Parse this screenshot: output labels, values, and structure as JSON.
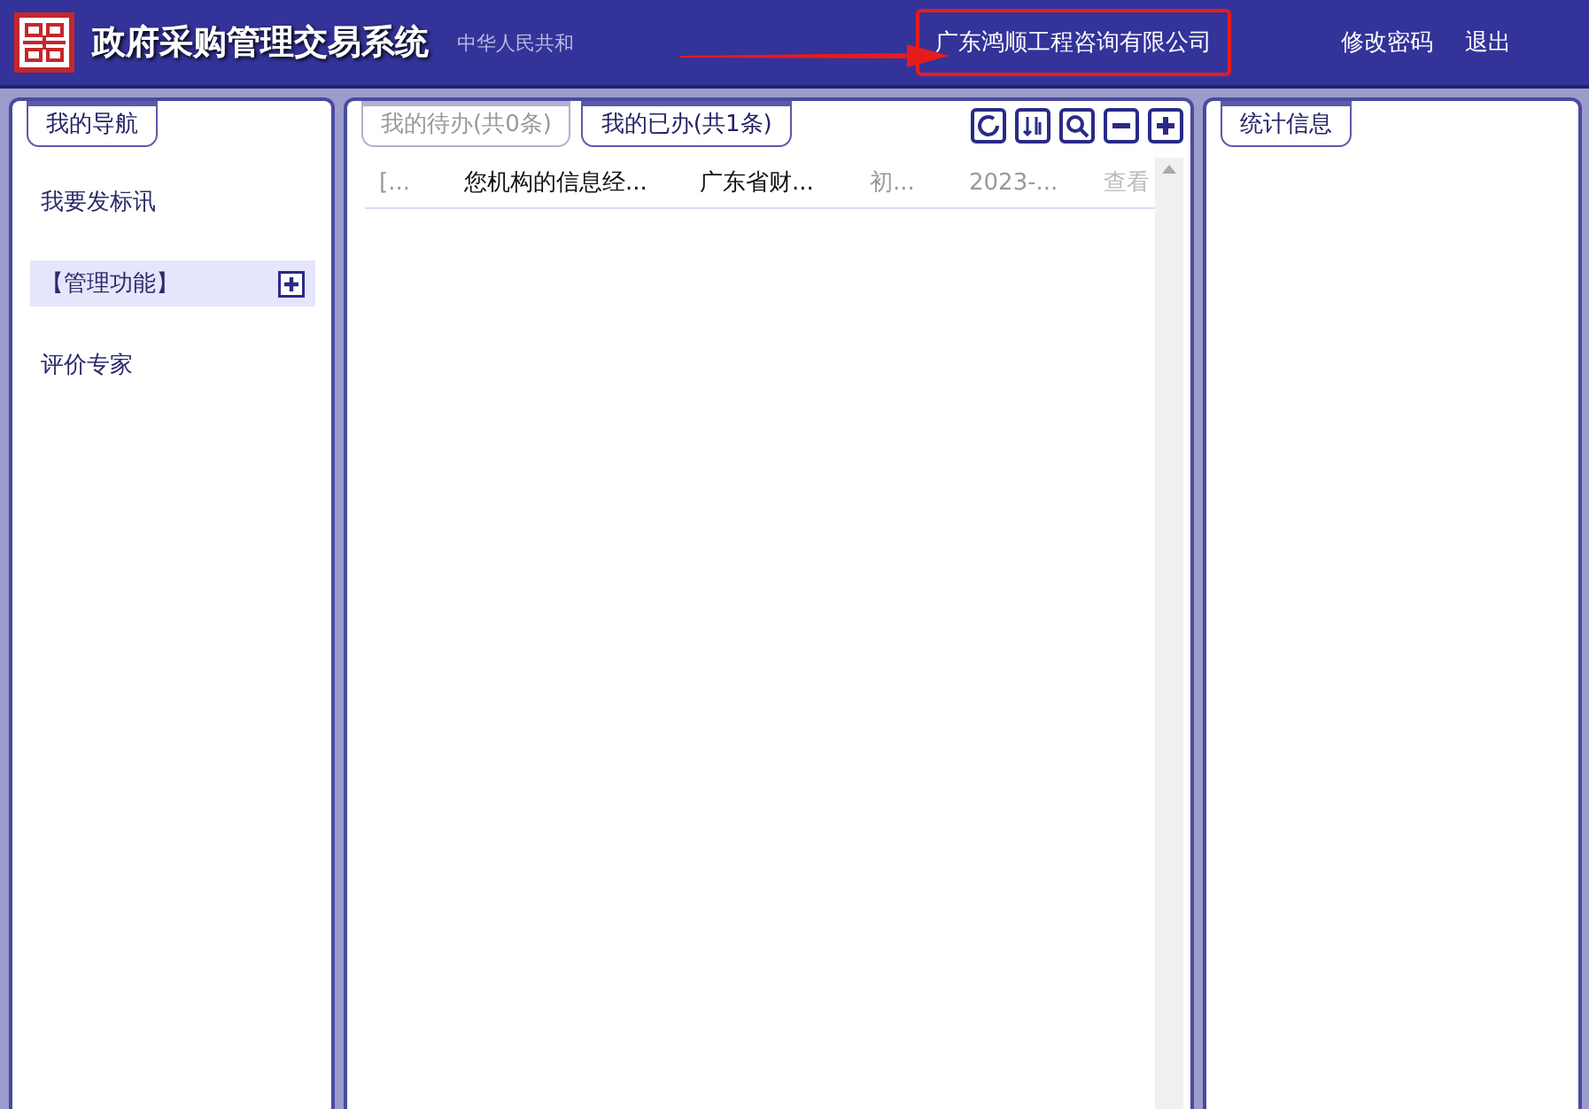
{
  "header": {
    "title": "政府采购管理交易系统",
    "subtitle": "中华人民共和",
    "company": "广东鸿顺工程咨询有限公司",
    "links": [
      "修改密码",
      "退出"
    ]
  },
  "nav": {
    "tab": "我的导航",
    "items": [
      {
        "label": "我要发标讯",
        "selected": false,
        "expandable": false
      },
      {
        "label": "【管理功能】",
        "selected": true,
        "expandable": true
      },
      {
        "label": "评价专家",
        "selected": false,
        "expandable": false
      }
    ]
  },
  "tasks": {
    "tabs": [
      {
        "label": "我的待办(共0条)",
        "selected": false
      },
      {
        "label": "我的已办(共1条)",
        "selected": true
      }
    ],
    "rows": [
      {
        "cells": [
          {
            "text": "[...",
            "muted": true
          },
          {
            "text": "您机构的信息经...",
            "muted": false
          },
          {
            "text": "广东省财...",
            "muted": false
          },
          {
            "text": "初...",
            "muted": true
          },
          {
            "text": "2023-...",
            "muted": true
          }
        ],
        "action": "查看"
      }
    ]
  },
  "stats": {
    "tab": "统计信息"
  }
}
